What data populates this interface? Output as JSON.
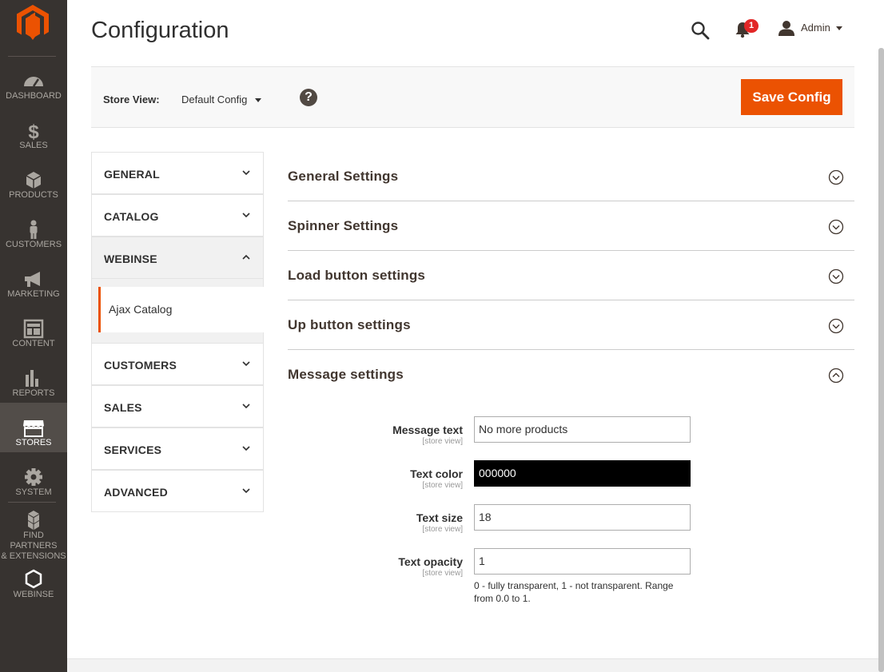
{
  "sidebar": {
    "logo_icon": "magento-logo-icon",
    "items": [
      {
        "label": "DASHBOARD",
        "icon": "dashboard-icon"
      },
      {
        "label": "SALES",
        "icon": "dollar-icon"
      },
      {
        "label": "PRODUCTS",
        "icon": "box-icon"
      },
      {
        "label": "CUSTOMERS",
        "icon": "person-icon"
      },
      {
        "label": "MARKETING",
        "icon": "megaphone-icon"
      },
      {
        "label": "CONTENT",
        "icon": "layout-icon"
      },
      {
        "label": "REPORTS",
        "icon": "bar-chart-icon"
      },
      {
        "label": "STORES",
        "icon": "storefront-icon"
      },
      {
        "label": "SYSTEM",
        "icon": "gear-icon"
      },
      {
        "label_line1": "FIND PARTNERS",
        "label_line2": "& EXTENSIONS",
        "icon": "cubes-icon"
      },
      {
        "label": "WEBINSE",
        "icon": "hexagon-icon"
      }
    ],
    "active": "STORES"
  },
  "header": {
    "title": "Configuration",
    "notifications_count": "1",
    "user_name": "Admin"
  },
  "store_bar": {
    "label": "Store View:",
    "selected": "Default Config",
    "help": "?",
    "save_label": "Save Config"
  },
  "tabs": [
    {
      "label": "GENERAL"
    },
    {
      "label": "CATALOG"
    },
    {
      "label": "WEBINSE",
      "subitems": [
        "Ajax Catalog"
      ]
    },
    {
      "label": "CUSTOMERS"
    },
    {
      "label": "SALES"
    },
    {
      "label": "SERVICES"
    },
    {
      "label": "ADVANCED"
    }
  ],
  "sections": [
    {
      "title": "General Settings"
    },
    {
      "title": "Spinner Settings"
    },
    {
      "title": "Load button settings"
    },
    {
      "title": "Up button settings"
    },
    {
      "title": "Message settings"
    }
  ],
  "form": {
    "fields": [
      {
        "label": "Message text",
        "scope": "[store view]",
        "value": "No more products"
      },
      {
        "label": "Text color",
        "scope": "[store view]",
        "value": "000000"
      },
      {
        "label": "Text size",
        "scope": "[store view]",
        "value": "18"
      },
      {
        "label": "Text opacity",
        "scope": "[store view]",
        "value": "1"
      }
    ],
    "opacity_note": "0 - fully transparent, 1 - not transparent. Range from 0.0 to 1."
  },
  "colors": {
    "accent": "#eb5202",
    "sidebar_bg": "#373330",
    "badge": "#e22626"
  }
}
